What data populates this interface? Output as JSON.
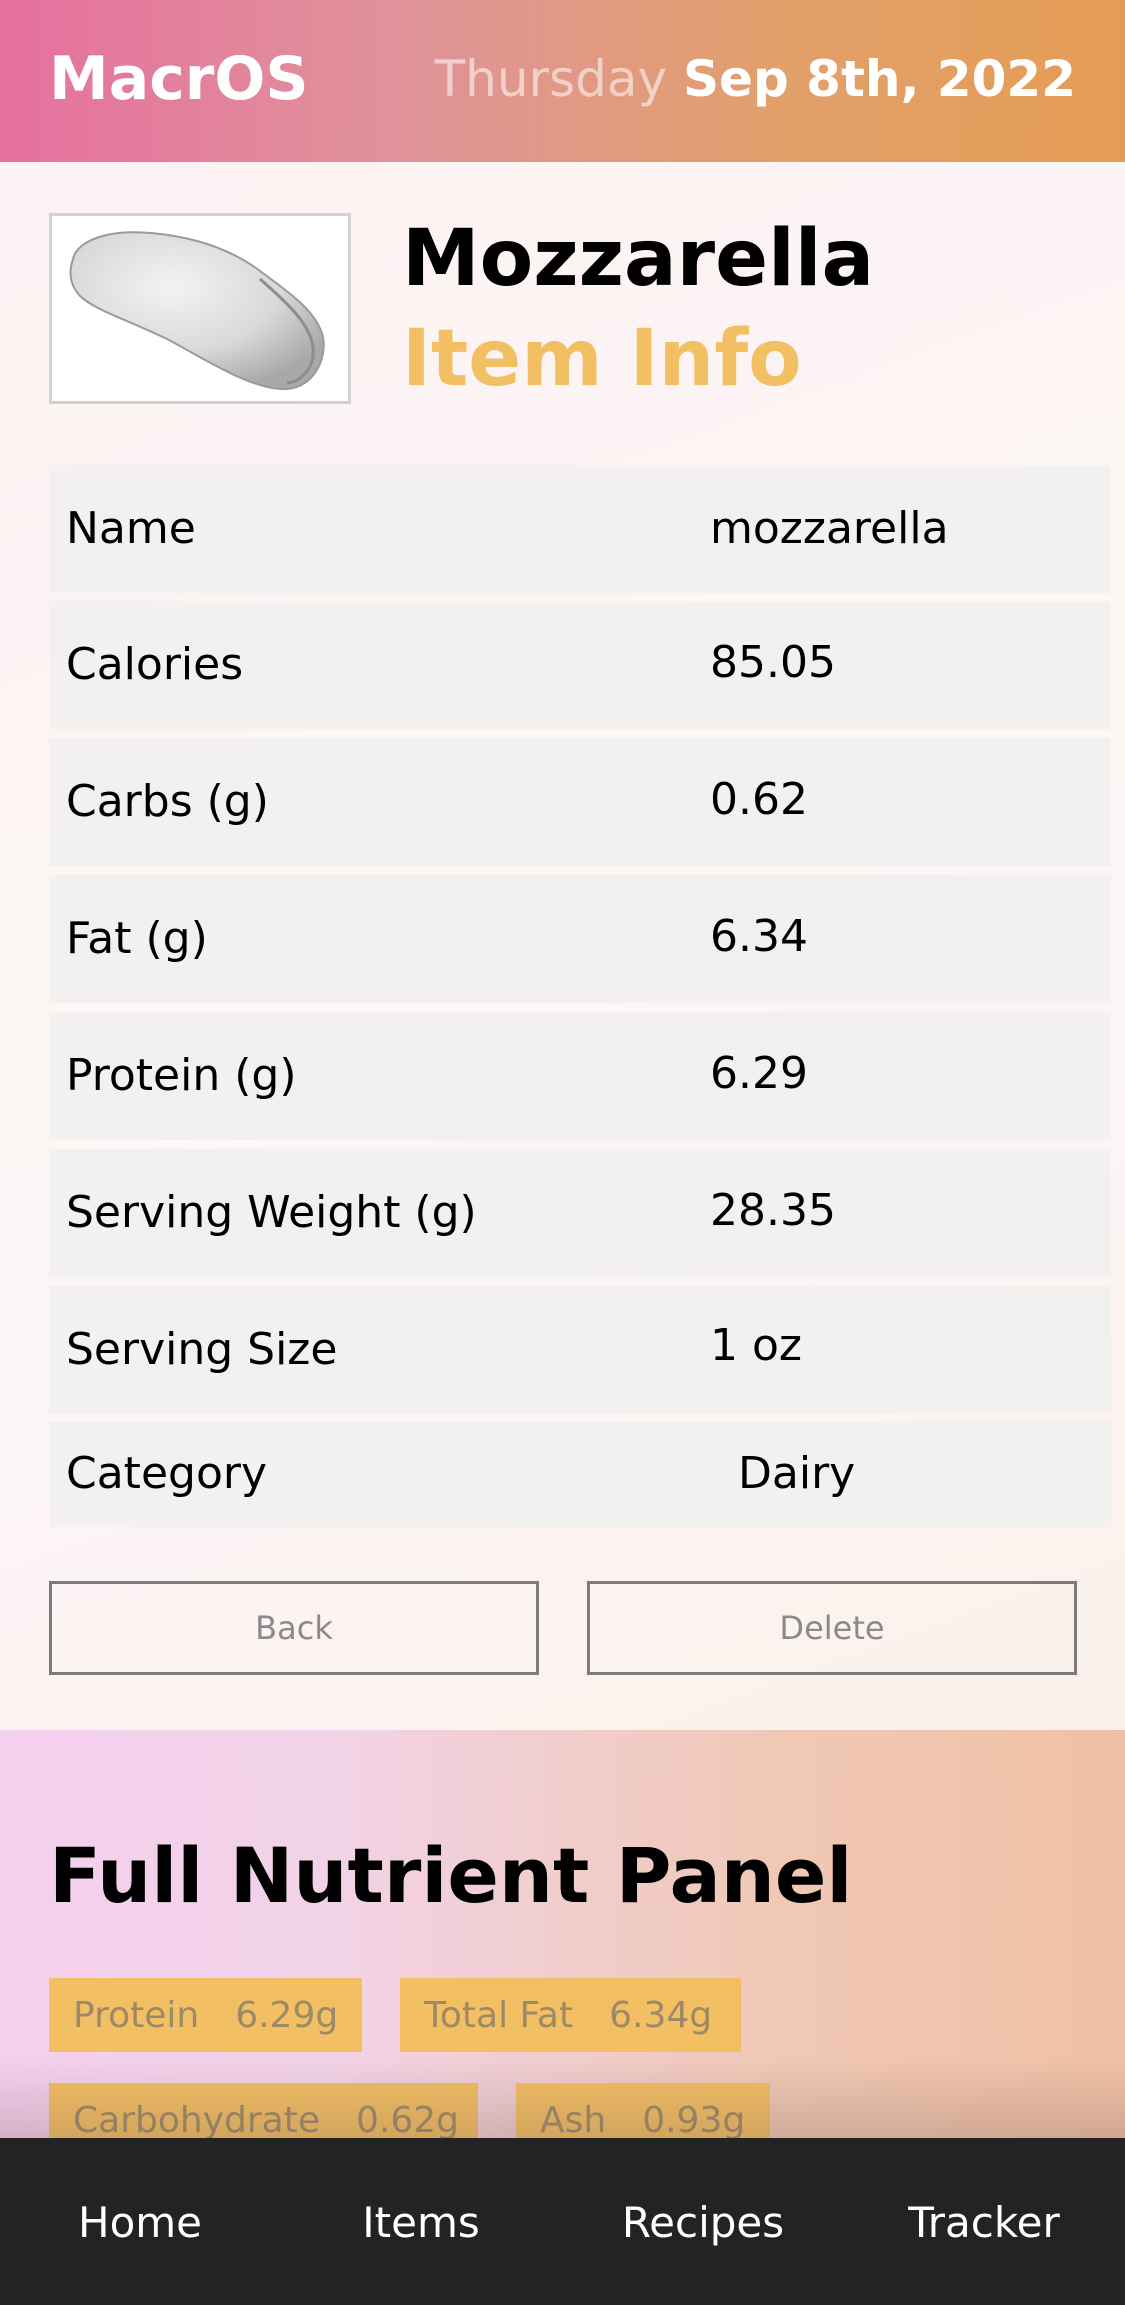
{
  "header": {
    "brand": "MacrOS",
    "weekday": "Thursday",
    "date": "Sep 8th, 2022"
  },
  "item": {
    "image_icon": "mozzarella-photo",
    "title": "Mozzarella",
    "subtitle": "Item Info"
  },
  "info": {
    "rows": [
      {
        "label": "Name",
        "value": "mozzarella"
      },
      {
        "label": "Calories",
        "value": "85.05"
      },
      {
        "label": "Carbs (g)",
        "value": "0.62"
      },
      {
        "label": "Fat (g)",
        "value": "6.34"
      },
      {
        "label": "Protein (g)",
        "value": "6.29"
      },
      {
        "label": "Serving Weight (g)",
        "value": "28.35"
      },
      {
        "label": "Serving Size",
        "value": "1 oz"
      },
      {
        "label": "Category",
        "value": "Dairy"
      }
    ]
  },
  "actions": {
    "back_label": "Back",
    "delete_label": "Delete"
  },
  "panel": {
    "title": "Full Nutrient Panel",
    "chips": [
      {
        "name": "Protein",
        "value": "6.29g"
      },
      {
        "name": "Total Fat",
        "value": "6.34g"
      },
      {
        "name": "Carbohydrate",
        "value": "0.62g"
      },
      {
        "name": "Ash",
        "value": "0.93g"
      }
    ]
  },
  "nav": {
    "items": [
      {
        "label": "Home"
      },
      {
        "label": "Items"
      },
      {
        "label": "Recipes"
      },
      {
        "label": "Tracker"
      }
    ]
  },
  "colors": {
    "accent": "#f2bf63",
    "nav_bg": "#232323"
  }
}
